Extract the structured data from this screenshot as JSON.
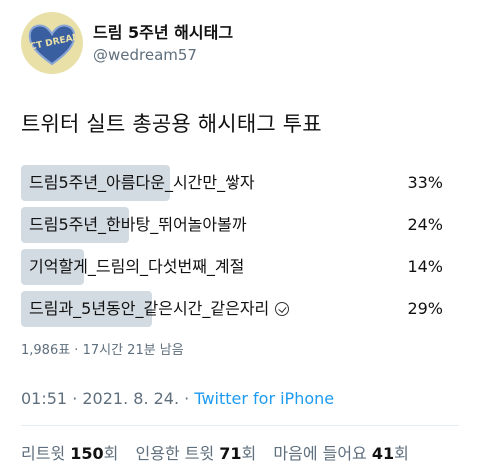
{
  "account": {
    "display_name": "드림 5주년 해시태그",
    "handle": "@wedream57",
    "avatar_text": "NCT DREAM"
  },
  "tweet": {
    "text": "트위터 실트 총공용 해시태그 투표"
  },
  "poll": {
    "options": [
      {
        "label": "드림5주년_아름다운_시간만_쌓자",
        "percent_text": "33%",
        "percent": 33
      },
      {
        "label": "드림5주년_한바탕_뛰어놀아볼까",
        "percent_text": "24%",
        "percent": 24
      },
      {
        "label": "기억할게_드림의_다섯번째_계절",
        "percent_text": "14%",
        "percent": 14
      },
      {
        "label": "드림과_5년동안_같은시간_같은자리",
        "percent_text": "29%",
        "percent": 29
      }
    ],
    "meta": "1,986표 · 17시간 21분 남음"
  },
  "timestamp": {
    "time": "01:51 · 2021. 8. 24. · ",
    "source": "Twitter for iPhone"
  },
  "stats": {
    "retweets_label": "리트윗",
    "retweets_count": "150",
    "retweets_unit": "회",
    "quotes_label": "인용한 트윗",
    "quotes_count": "71",
    "quotes_unit": "회",
    "likes_label": "마음에 들어요",
    "likes_count": "41",
    "likes_unit": "회"
  },
  "colors": {
    "bar": "#d3dbe2",
    "link": "#1d9bf0",
    "muted": "#5f6f7d"
  }
}
